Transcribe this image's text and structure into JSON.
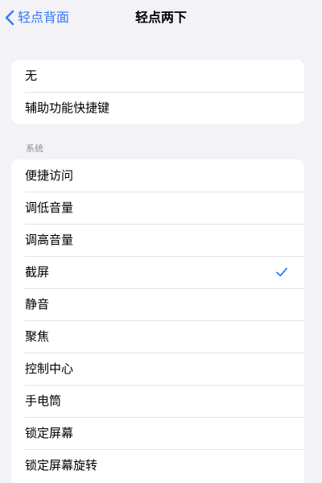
{
  "nav": {
    "back_label": "轻点背面",
    "title": "轻点两下"
  },
  "group1": {
    "items": [
      {
        "label": "无"
      },
      {
        "label": "辅助功能快捷键"
      }
    ]
  },
  "system": {
    "header": "系统",
    "items": [
      {
        "label": "便捷访问"
      },
      {
        "label": "调低音量"
      },
      {
        "label": "调高音量"
      },
      {
        "label": "截屏",
        "selected": true
      },
      {
        "label": "静音"
      },
      {
        "label": "聚焦"
      },
      {
        "label": "控制中心"
      },
      {
        "label": "手电筒"
      },
      {
        "label": "锁定屏幕"
      },
      {
        "label": "锁定屏幕旋转"
      }
    ]
  },
  "colors": {
    "accent": "#3478f6",
    "background": "#f2f2f7",
    "separator": "#e3e3e8",
    "section_header": "#8e8e93"
  },
  "icons": {
    "back": "chevron-left-icon",
    "selected": "checkmark-icon"
  }
}
